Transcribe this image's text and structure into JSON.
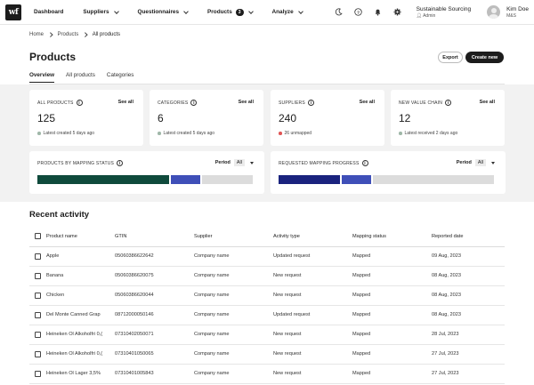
{
  "nav": {
    "logo": "wf",
    "items": [
      {
        "label": "Dashboard",
        "chevron": false
      },
      {
        "label": "Suppliers",
        "chevron": true
      },
      {
        "label": "Questionnaires",
        "chevron": true
      },
      {
        "label": "Products",
        "chevron": true,
        "badge": "3"
      },
      {
        "label": "Analyze",
        "chevron": true
      }
    ],
    "org_name": "Sustainable Sourcing",
    "org_role": "Admin",
    "user_name": "Kim Doe",
    "user_org": "M&S"
  },
  "breadcrumb": [
    "Home",
    "Products",
    "All products"
  ],
  "page": {
    "title": "Products",
    "export_label": "Export",
    "create_label": "Create new"
  },
  "tabs": [
    "Overview",
    "All products",
    "Categories"
  ],
  "stats": [
    {
      "label": "ALL PRODUCTS",
      "see_all": "See all",
      "value": "125",
      "note": "Latest created 5 days ago",
      "dot_color": "#9fb7a8"
    },
    {
      "label": "CATEGORIES",
      "see_all": "See all",
      "value": "6",
      "note": "Latest created 5 days ago",
      "dot_color": "#9fb7a8"
    },
    {
      "label": "SUPPLIERS",
      "see_all": "See all",
      "value": "240",
      "note": "26 unmapped",
      "dot_color": "#e05555"
    },
    {
      "label": "NEW VALUE CHAIN",
      "see_all": "See all",
      "value": "12",
      "note": "Latest received 2 days ago",
      "dot_color": "#9fb7a8"
    }
  ],
  "mapping": [
    {
      "label": "PRODUCTS BY MAPPING STATUS",
      "period_label": "Period",
      "period_value": "All",
      "segments": [
        {
          "share": 0.62,
          "color": "#0f4a3c"
        },
        {
          "share": 0.14,
          "color": "#3f4fb8"
        },
        {
          "share": 0.24,
          "color": "#dcdcdc"
        }
      ]
    },
    {
      "label": "REQUESTED MAPPING PROGRESS",
      "period_label": "Period",
      "period_value": "All",
      "segments": [
        {
          "share": 0.29,
          "color": "#1a237e"
        },
        {
          "share": 0.14,
          "color": "#3f4fb8"
        },
        {
          "share": 0.57,
          "color": "#dcdcdc"
        }
      ]
    }
  ],
  "recent": {
    "title": "Recent activity",
    "columns": [
      "Product name",
      "GTIN",
      "Supplier",
      "Activity type",
      "Mapping status",
      "Reported date"
    ],
    "rows": [
      [
        "Apple",
        "05060386622642",
        "Company name",
        "Updated request",
        "Mapped",
        "09 Aug, 2023"
      ],
      [
        "Banana",
        "05060386620075",
        "Company name",
        "New request",
        "Mapped",
        "08 Aug, 2023"
      ],
      [
        "Chicken",
        "05060386620044",
        "Company name",
        "New request",
        "Mapped",
        "08 Aug, 2023"
      ],
      [
        "Del Monte Canned Grap",
        "08712000050146",
        "Company name",
        "Updated request",
        "Mapped",
        "08 Aug, 2023"
      ],
      [
        "Heineken Öl Alkoholfri 0,(",
        "07310402050071",
        "Company name",
        "New request",
        "Mapped",
        "28 Jul, 2023"
      ],
      [
        "Heineken Öl Alkoholfri 0,(",
        "07310401050065",
        "Company name",
        "New request",
        "Mapped",
        "27 Jul, 2023"
      ],
      [
        "Heineken Öl Lager 3,5%",
        "07310401005843",
        "Company name",
        "New request",
        "Mapped",
        "27 Jul, 2023"
      ]
    ]
  }
}
